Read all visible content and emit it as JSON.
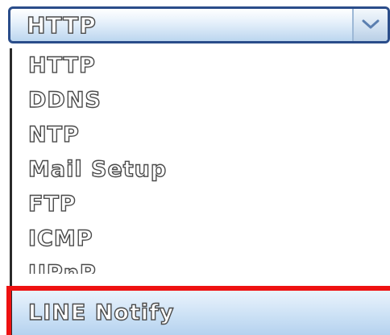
{
  "select": {
    "selected_value": "HTTP",
    "arrow_icon": "chevron-down-icon"
  },
  "options": [
    {
      "label": "HTTP"
    },
    {
      "label": "DDNS"
    },
    {
      "label": "NTP"
    },
    {
      "label": "Mail Setup"
    },
    {
      "label": "FTP"
    },
    {
      "label": "ICMP"
    },
    {
      "label": "UPnP"
    },
    {
      "label": "LINE Notify"
    }
  ],
  "highlight": {
    "option_label": "LINE Notify",
    "frame_color": "#ee1111"
  },
  "colors": {
    "select_border": "#2a4d8a",
    "highlight_fill": "#cfe3f6"
  }
}
